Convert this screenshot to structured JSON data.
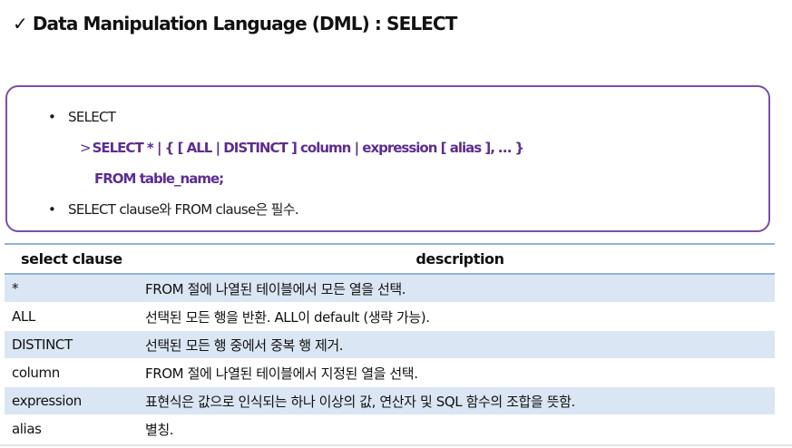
{
  "header": {
    "check_glyph": "✓",
    "title": "Data Manipulation Language (DML) : SELECT"
  },
  "syntax_box": {
    "bullet_glyph": "•",
    "keyword": "SELECT",
    "arrow_glyph": ">",
    "syntax_line1": "SELECT * | { [ ALL | DISTINCT ] column | expression [ alias ], … }",
    "syntax_line2": "FROM table_name;",
    "note": "SELECT clause와 FROM clause은 필수."
  },
  "table": {
    "headers": {
      "clause": "select clause",
      "description": "description"
    },
    "rows": [
      {
        "clause": "*",
        "description": "FROM 절에 나열된 테이블에서 모든 열을 선택."
      },
      {
        "clause": "ALL",
        "description": "선택된 모든 행을 반환. ALL이 default (생략 가능)."
      },
      {
        "clause": "DISTINCT",
        "description": "선택된 모든 행 중에서 중복 행 제거."
      },
      {
        "clause": "column",
        "description": "FROM 절에 나열된 테이블에서 지정된 열을 선택."
      },
      {
        "clause": "expression",
        "description": "표현식은 값으로 인식되는 하나 이상의 값, 연산자 및 SQL 함수의 조합을 뜻함."
      },
      {
        "clause": "alias",
        "description": "별칭."
      }
    ]
  },
  "colors": {
    "box_border": "#7b4fa6",
    "syntax_text": "#5c2d91",
    "row_shade": "#dbe6f4",
    "table_rule": "#8fb3d9"
  }
}
